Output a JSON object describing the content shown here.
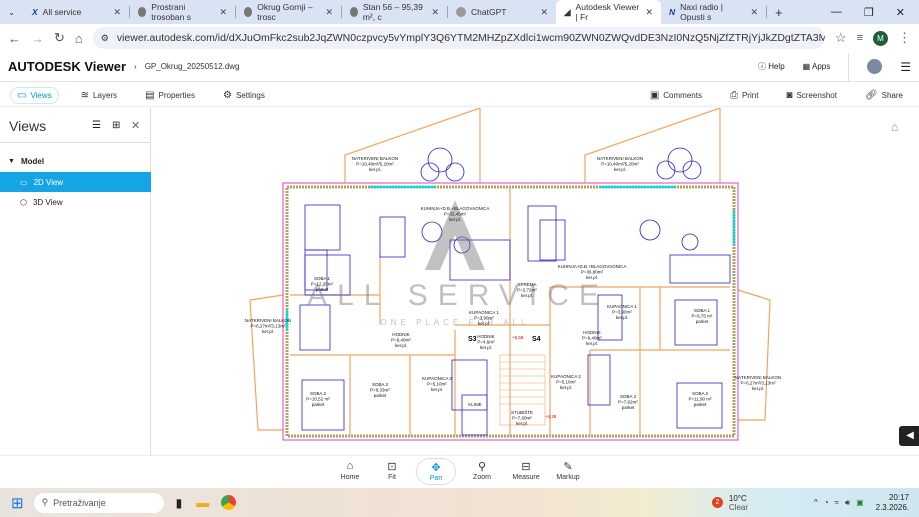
{
  "browser": {
    "tabs": [
      {
        "label": "All service"
      },
      {
        "label": "Prostrani trosoban s"
      },
      {
        "label": "Okrug Gornji – trosc"
      },
      {
        "label": "Stan 56 – 95,39 m², c"
      },
      {
        "label": "ChatGPT"
      },
      {
        "label": "Autodesk Viewer | Fr",
        "active": true
      },
      {
        "label": "Naxi radio | Opusti s"
      }
    ],
    "url": "viewer.autodesk.com/id/dXJuOmFkc2sub2JqZWN0czpvcy5vYmplY3Q6YTM2MHZpZXdlci1wcm90ZWN0ZWQvdDE3NzI0NzQ5NjZfZTRjYjJkZDgtZTA3MC00MTFiLTk2NDMtNDcyNmNmZDAxZ...",
    "profile_initial": "M"
  },
  "app": {
    "logo": "AUTODESK Viewer",
    "file": "GP_Okrug_20250512.dwg",
    "help": "Help",
    "apps": "Apps",
    "toolbar_left": [
      "Views",
      "Layers",
      "Properties",
      "Settings"
    ],
    "toolbar_right": [
      "Comments",
      "Print",
      "Screenshot",
      "Share"
    ]
  },
  "views_panel": {
    "title": "Views",
    "group": "Model",
    "items": [
      "2D View",
      "3D View"
    ],
    "selected": "2D View"
  },
  "drawing": {
    "watermark": "ALL SERVICE",
    "watermark_sub": "ONE PLACE FOR ALL",
    "labels": [
      [
        "NATKRIVENI BALKON",
        "P=10,40m²/5,20m²",
        "ker.pl."
      ],
      [
        "NATKRIVENI BALKON",
        "P=10,40m²/5,20m²",
        "ker.pl."
      ],
      [
        "KUHINJA+D.B.+BLAGOVAONICA",
        "P=32,45m²",
        "ker.pl."
      ],
      [
        "KUHINJA+D.B.+BLAGOVAONICA",
        "P=36,80m²",
        "ker.pl."
      ],
      [
        "SOBA 1",
        "P=12,20m²",
        "parket"
      ],
      [
        "SPREMA",
        "P=2,72m²",
        "ker.pl."
      ],
      [
        "KUPAONICA 1",
        "P=3,90m²",
        "ker.pl."
      ],
      [
        "KUPAONICA 1",
        "P=3,90m²",
        "ker.pl."
      ],
      [
        "SOBA 1",
        "P=9,75 m²",
        "parket"
      ],
      [
        "NATKRIVENI BALKON",
        "P=6,27m²/3,13m²",
        "ker.pl."
      ],
      [
        "HODNIK",
        "P=9,40m²",
        "ker.pl."
      ],
      [
        "HODNIK",
        "P=4,6m²",
        "ker.pl."
      ],
      [
        "HODNIK",
        "P=9,40m²",
        "ker.pl."
      ],
      [
        "SOBA 2",
        "P=10,52 m²",
        "parket"
      ],
      [
        "SOBA 3",
        "P=8,33m²",
        "parket"
      ],
      [
        "KUPAONICA 2",
        "P=5,10m²",
        "ker.pl."
      ],
      [
        "KLIME",
        "",
        ""
      ],
      [
        "STUBIŠTE",
        "P=7,60m²",
        "ker.pl."
      ],
      [
        "KUPAONICA 2",
        "P=5,10m²",
        "ker.pl."
      ],
      [
        "SOBA 3",
        "P=7,62m²",
        "parket"
      ],
      [
        "SOBA 2",
        "P=11,90 m²",
        "parket"
      ],
      [
        "NATKRIVENI BALKON",
        "P=6,27m²/3,13m²",
        "ker.pl."
      ]
    ],
    "units": [
      "S3",
      "S4"
    ],
    "levels": [
      "+5,58",
      "+4,28"
    ]
  },
  "bottom_toolbar": {
    "items": [
      "Home",
      "Fit",
      "Pan",
      "Zoom",
      "Measure",
      "Markup"
    ],
    "active": "Pan"
  },
  "taskbar": {
    "search": "Pretraživanje",
    "weather_temp": "10°C",
    "weather_desc": "Clear",
    "weather_badge": "2",
    "time": "20:17",
    "date": "2.3.2026."
  },
  "colors": {
    "accent": "#0696d7",
    "selected": "#15a5e5",
    "walls": "#f4a460",
    "furniture": "#2323c8",
    "outline": "#e040c0",
    "glass": "#00e0e0"
  }
}
